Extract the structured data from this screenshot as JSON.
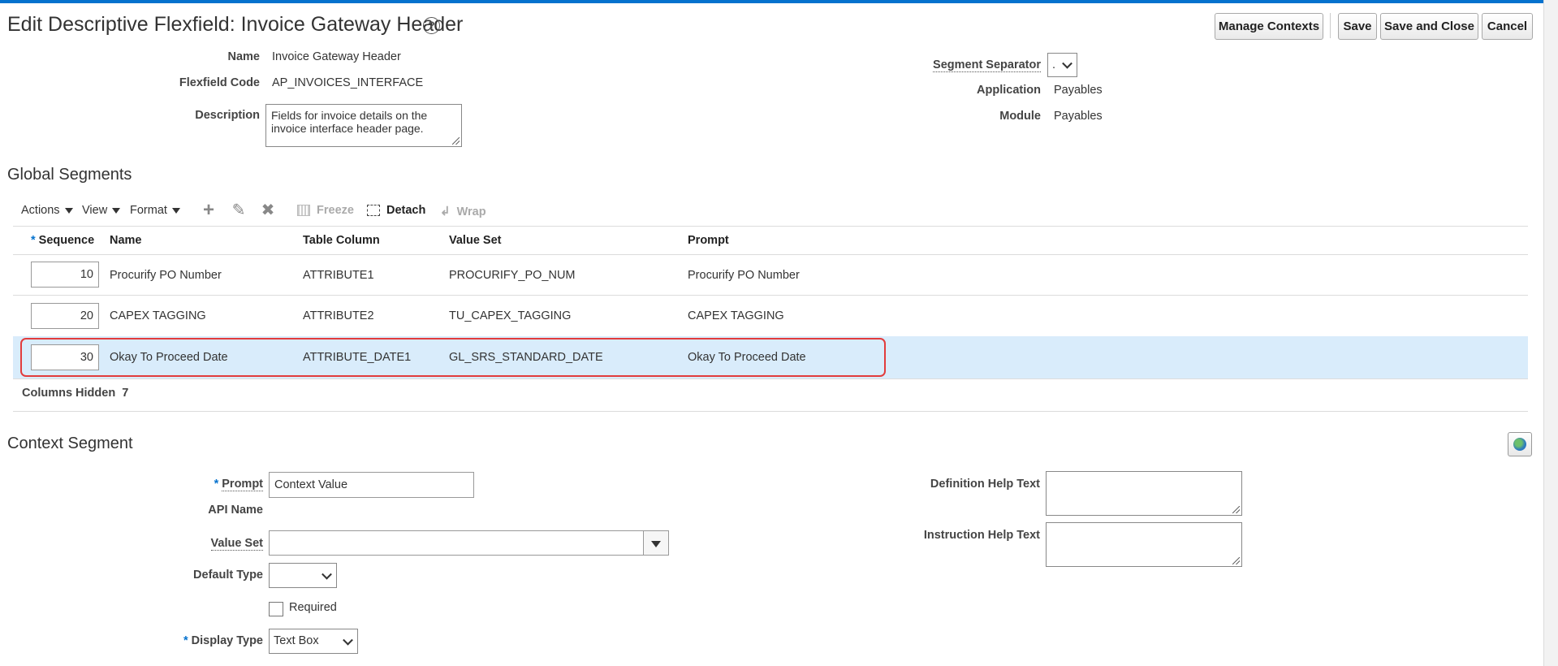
{
  "header": {
    "title": "Edit Descriptive Flexfield: Invoice Gateway Header",
    "help_glyph": "?",
    "buttons": {
      "manage_contexts": "Manage Contexts",
      "save": "Save",
      "save_and_close": "Save and Close",
      "cancel": "Cancel"
    }
  },
  "form": {
    "name_label": "Name",
    "name_value": "Invoice Gateway Header",
    "code_label": "Flexfield Code",
    "code_value": "AP_INVOICES_INTERFACE",
    "description_label": "Description",
    "description_value": "Fields for invoice details on the invoice interface header page.",
    "separator_label": "Segment Separator",
    "separator_value": ".",
    "application_label": "Application",
    "application_value": "Payables",
    "module_label": "Module",
    "module_value": "Payables"
  },
  "global_segments": {
    "title": "Global Segments",
    "toolbar": {
      "actions": "Actions",
      "view": "View",
      "format": "Format",
      "freeze": "Freeze",
      "detach": "Detach",
      "wrap": "Wrap"
    },
    "columns": {
      "sequence": "Sequence",
      "name": "Name",
      "table_column": "Table Column",
      "value_set": "Value Set",
      "prompt": "Prompt"
    },
    "rows": [
      {
        "sequence": "10",
        "name": "Procurify PO Number",
        "table_column": "ATTRIBUTE1",
        "value_set": "PROCURIFY_PO_NUM",
        "prompt": "Procurify PO Number"
      },
      {
        "sequence": "20",
        "name": "CAPEX TAGGING",
        "table_column": "ATTRIBUTE2",
        "value_set": "TU_CAPEX_TAGGING",
        "prompt": "CAPEX TAGGING"
      },
      {
        "sequence": "30",
        "name": "Okay To Proceed Date",
        "table_column": "ATTRIBUTE_DATE1",
        "value_set": "GL_SRS_STANDARD_DATE",
        "prompt": "Okay To Proceed Date"
      }
    ],
    "columns_hidden_label": "Columns Hidden",
    "columns_hidden_count": "7"
  },
  "context_segment": {
    "title": "Context Segment",
    "prompt_label": "Prompt",
    "prompt_value": "Context Value",
    "api_name_label": "API Name",
    "value_set_label": "Value Set",
    "value_set_value": "",
    "default_type_label": "Default Type",
    "default_type_value": "",
    "required_label": "Required",
    "display_type_label": "Display Type",
    "display_type_value": "Text Box",
    "definition_help_label": "Definition Help Text",
    "instruction_help_label": "Instruction Help Text"
  },
  "colors": {
    "accent": "#0572ce",
    "selected_row": "#d9ecfb",
    "highlight_border": "#e23c3c"
  }
}
